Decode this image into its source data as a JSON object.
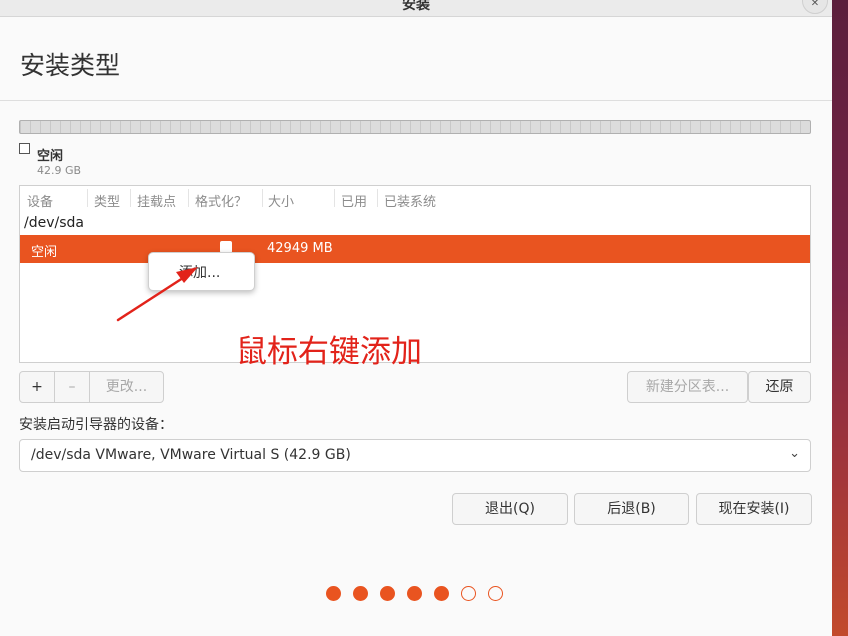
{
  "window": {
    "title": "安装"
  },
  "page": {
    "title": "安装类型"
  },
  "disk_legend": {
    "label": "空闲",
    "size": "42.9 GB"
  },
  "table": {
    "headers": [
      "设备",
      "类型",
      "挂载点",
      "格式化？",
      "大小",
      "已用",
      "已装系统"
    ],
    "device": "/dev/sda",
    "selected_row": {
      "device": "空闲",
      "size": "42949 MB"
    }
  },
  "context_menu": {
    "add_label": "添加..."
  },
  "annotation": {
    "text": "鼠标右键添加"
  },
  "partition_buttons": {
    "add": "+",
    "remove": "–",
    "change": "更改..."
  },
  "new_table_button": "新建分区表...",
  "revert_button": "还原",
  "boot_loader": {
    "label": "安装启动引导器的设备：",
    "selected": "/dev/sda VMware, VMware Virtual S (42.9 GB)"
  },
  "nav": {
    "quit": "退出(Q)",
    "back": "后退(B)",
    "install": "现在安装(I)"
  },
  "progress": {
    "total_steps": 7,
    "completed_steps": 5
  },
  "colors": {
    "accent": "#e95420",
    "annotation": "#e2231a"
  },
  "icons": {
    "close": "close-icon",
    "chevron": "chevron-down-icon",
    "checkbox": "checkbox-icon"
  }
}
